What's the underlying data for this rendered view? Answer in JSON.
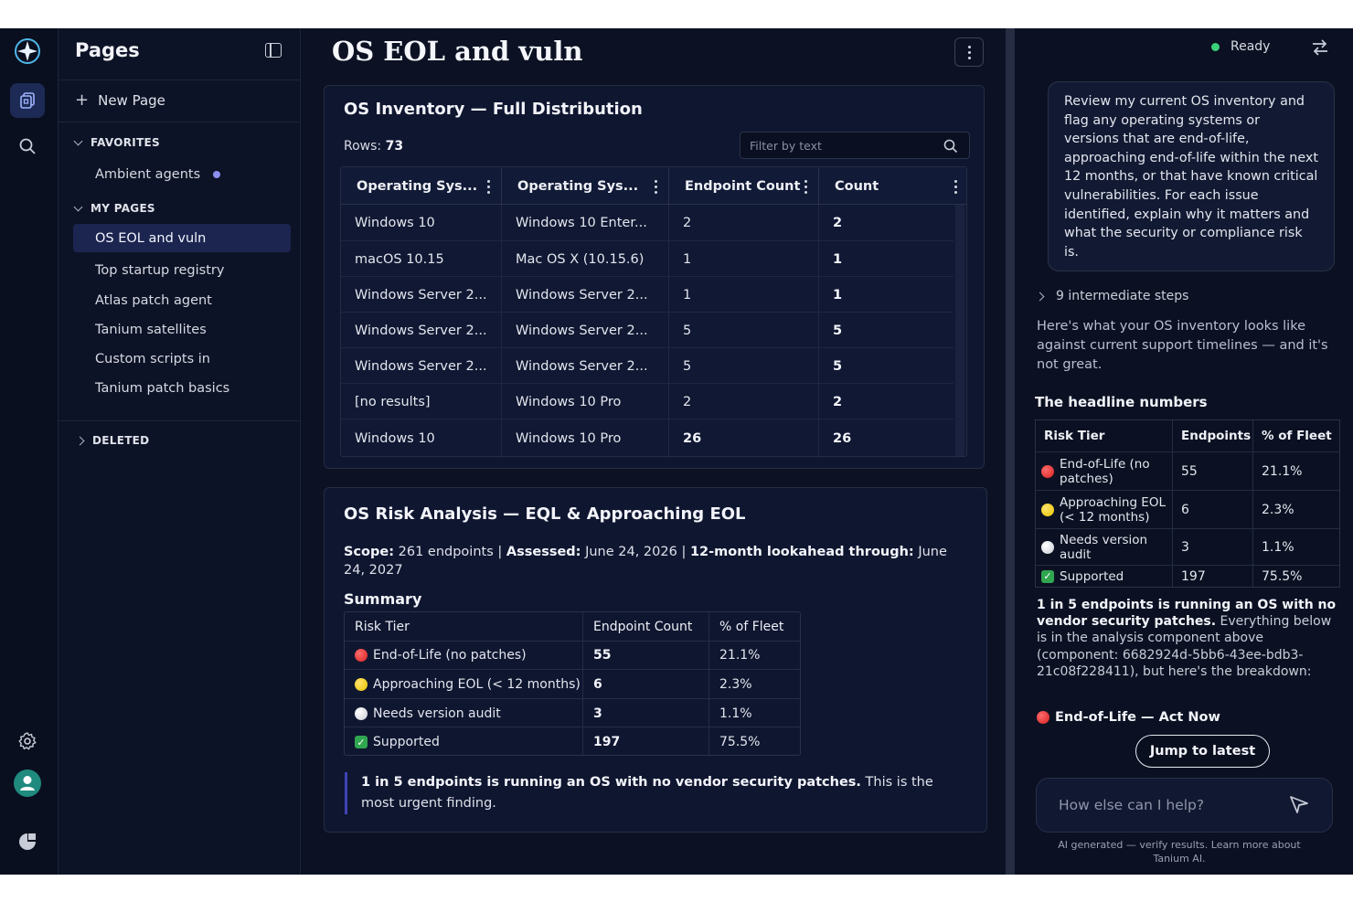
{
  "sidebar": {
    "title": "Pages",
    "new_page": "New Page",
    "favorites_label": "FAVORITES",
    "favorites": [
      {
        "label": "Ambient agents"
      }
    ],
    "my_pages_label": "MY PAGES",
    "my_pages": [
      {
        "label": "OS EOL and vuln",
        "active": true
      },
      {
        "label": "Top startup registry"
      },
      {
        "label": "Atlas patch agent"
      },
      {
        "label": "Tanium satellites"
      },
      {
        "label": "Custom scripts in"
      },
      {
        "label": "Tanium patch basics"
      }
    ],
    "deleted_label": "DELETED"
  },
  "main": {
    "title": "OS EOL and vuln",
    "inventory": {
      "title": "OS Inventory — Full Distribution",
      "rows_label": "Rows:",
      "rows_value": "73",
      "filter_placeholder": "Filter by text",
      "columns": [
        "Operating Sys...",
        "Operating Sys...",
        "Endpoint Count",
        "Count"
      ],
      "rows": [
        [
          "Windows 10",
          "Windows 10 Enter...",
          "2",
          "2"
        ],
        [
          "macOS 10.15",
          "Mac OS X (10.15.6)",
          "1",
          "1"
        ],
        [
          "Windows Server 2...",
          "Windows Server 2...",
          "1",
          "1"
        ],
        [
          "Windows Server 2...",
          "Windows Server 2...",
          "5",
          "5"
        ],
        [
          "Windows Server 2...",
          "Windows Server 2...",
          "5",
          "5"
        ],
        [
          "[no results]",
          "Windows 10 Pro",
          "2",
          "2"
        ],
        [
          "Windows 10",
          "Windows 10 Pro",
          "26",
          "26"
        ]
      ]
    },
    "risk": {
      "title": "OS Risk Analysis — EQL & Approaching EOL",
      "scope_label": "Scope:",
      "scope_value": "261 endpoints",
      "assessed_label": "Assessed:",
      "assessed_value": "June 24, 2026",
      "lookahead_label": "12-month lookahead through:",
      "lookahead_value": "June 24, 2027",
      "separator": "|",
      "summary_title": "Summary",
      "summary_columns": [
        "Risk Tier",
        "Endpoint Count",
        "% of Fleet"
      ],
      "summary_rows": [
        {
          "icon": "red-circle-icon",
          "tier": "End-of-Life (no patches)",
          "count": "55",
          "pct": "21.1%"
        },
        {
          "icon": "yellow-circle-icon",
          "tier": "Approaching EOL (< 12 months)",
          "count": "6",
          "pct": "2.3%"
        },
        {
          "icon": "white-circle-icon",
          "tier": "Needs version audit",
          "count": "3",
          "pct": "1.1%"
        },
        {
          "icon": "green-check-icon",
          "tier": "Supported",
          "count": "197",
          "pct": "75.5%"
        }
      ],
      "callout_bold": "1 in 5 endpoints is running an OS with no vendor security patches.",
      "callout_rest": "This is the most urgent finding."
    }
  },
  "chat": {
    "status": "Ready",
    "prompt": "Review my current OS inventory and flag any operating systems or versions that are end-of-life, approaching end-of-life within the next 12 months, or that have known critical vulnerabilities. For each issue identified, explain why it matters and what the security or compliance risk is.",
    "steps_label": "9 intermediate steps",
    "intro": "Here's what your OS inventory looks like against current support timelines — and it's not great.",
    "headline_title": "The headline numbers",
    "headline_columns": [
      "Risk Tier",
      "Endpoints",
      "% of Fleet"
    ],
    "headline_rows": [
      {
        "icon": "red-circle-icon",
        "tier": "End-of-Life (no patches)",
        "count": "55",
        "pct": "21.1%"
      },
      {
        "icon": "yellow-circle-icon",
        "tier": "Approaching EOL (< 12 months)",
        "count": "6",
        "pct": "2.3%"
      },
      {
        "icon": "white-circle-icon",
        "tier": "Needs version audit",
        "count": "3",
        "pct": "1.1%"
      },
      {
        "icon": "green-check-icon",
        "tier": "Supported",
        "count": "197",
        "pct": "75.5%"
      }
    ],
    "para_bold": "1 in 5 endpoints is running an OS with no vendor security patches.",
    "para_rest": "Everything below is in the analysis component above (component: 6682924d-5bb6-43ee-bdb3-21c08f228411), but here's the breakdown:",
    "eol_heading": "End-of-Life — Act Now",
    "jump_button": "Jump to latest",
    "input_placeholder": "How else can I help?",
    "disclaimer": "AI generated — verify results. Learn more about Tanium AI."
  }
}
